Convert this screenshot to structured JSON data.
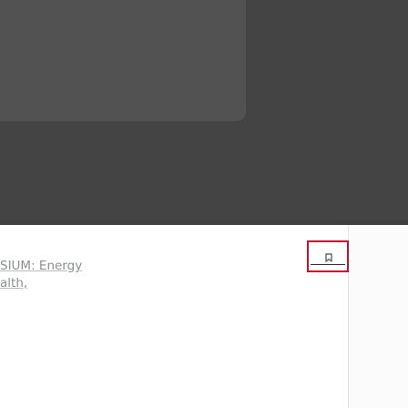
{
  "article": {
    "link_line_1": "SIUM: Energy",
    "link_line_2": "alth,"
  },
  "toolbar": {
    "highlighted_icon": "bookmark-icon"
  },
  "colors": {
    "dark_background": "#444444",
    "video_panel": "#525252",
    "highlight_border": "#c8102e",
    "link_text": "#8a8f8f"
  }
}
